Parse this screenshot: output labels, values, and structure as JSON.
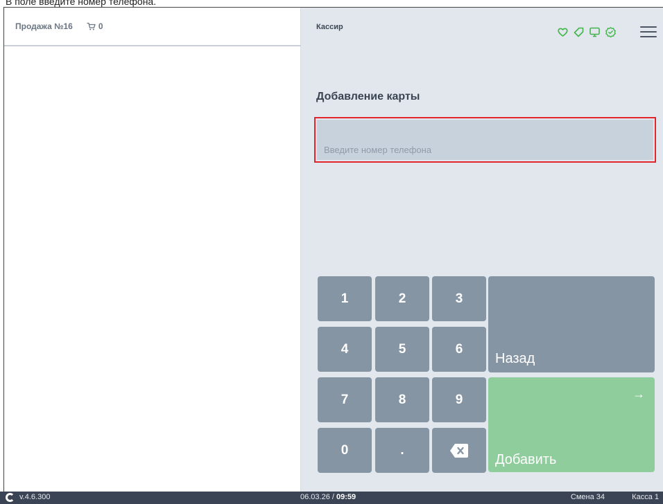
{
  "caption": "В поле введите номер телефона.",
  "sale": {
    "title": "Продажа №16",
    "cart_count": "0"
  },
  "header": {
    "role": "Кассир"
  },
  "form": {
    "title": "Добавление карты",
    "phone_value": "",
    "phone_placeholder": "Введите номер телефона"
  },
  "keypad": {
    "keys": [
      "1",
      "2",
      "3",
      "4",
      "5",
      "6",
      "7",
      "8",
      "9",
      "0",
      "."
    ],
    "back_label": "Назад",
    "add_label": "Добавить",
    "add_arrow": "→"
  },
  "status": {
    "version": "v.4.6.300",
    "date": "06.03.26",
    "time": "09:59",
    "shift": "Смена 34",
    "register": "Касса 1"
  },
  "icons": [
    "heart-icon",
    "tag-icon",
    "monitor-icon",
    "check-badge-icon",
    "menu-icon",
    "cart-icon",
    "backspace-icon",
    "arrow-right-icon",
    "app-logo-icon"
  ],
  "colors": {
    "accent_green": "#41b54a",
    "add_button": "#8fce9c",
    "key": "#8695a4",
    "highlight_red": "#e3242b",
    "statusbar": "#3b4454"
  }
}
